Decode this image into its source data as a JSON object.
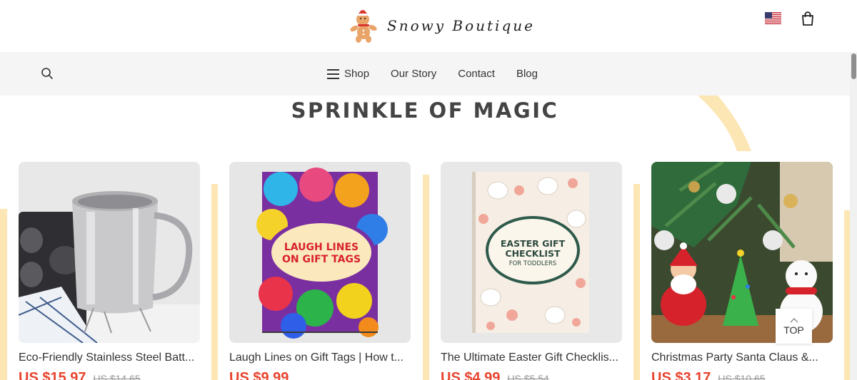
{
  "brand": {
    "name": "Snowy Boutique",
    "logo_icon": "gingerbread-man-icon"
  },
  "header": {
    "flag_icon": "us-flag-icon",
    "cart_icon": "shopping-bag-icon"
  },
  "nav": {
    "search_icon": "search-icon",
    "menu_icon": "hamburger-menu-icon",
    "items": [
      {
        "label": "Shop"
      },
      {
        "label": "Our Story"
      },
      {
        "label": "Contact"
      },
      {
        "label": "Blog"
      }
    ]
  },
  "section": {
    "title": "SPRINKLE OF MAGIC"
  },
  "products": [
    {
      "title": "Eco-Friendly Stainless Steel Batt...",
      "price": "US $15.97",
      "old_price": "US $14.65"
    },
    {
      "title": "Laugh Lines on Gift Tags | How t...",
      "price": "US $9.99",
      "old_price": "",
      "cover_text": "LAUGH LINES ON GIFT TAGS"
    },
    {
      "title": "The Ultimate Easter Gift Checklis...",
      "price": "US $4.99",
      "old_price": "US $5.54",
      "cover_title": "EASTER GIFT CHECKLIST",
      "cover_sub": "FOR TODDLERS"
    },
    {
      "title": "Christmas Party Santa Claus &...",
      "price": "US $3.17",
      "old_price": "US $10.65"
    }
  ],
  "top_button": {
    "label": "TOP"
  },
  "colors": {
    "accent": "#e8442e",
    "deco": "#fce6b4",
    "nav_bg": "#f5f5f5"
  }
}
